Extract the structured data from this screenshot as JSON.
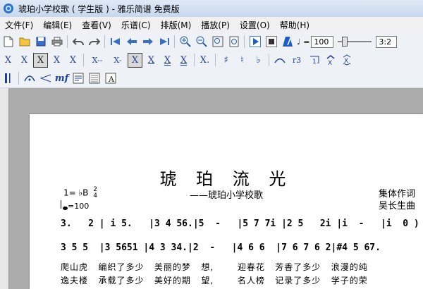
{
  "window": {
    "title": "琥珀小学校歌 ( 学生版 ) - 雅乐简谱 免费版"
  },
  "menu": [
    "文件(F)",
    "编辑(E)",
    "查看(V)",
    "乐谱(C)",
    "排版(M)",
    "播放(P)",
    "设置(O)",
    "帮助(H)"
  ],
  "toolbar1": {
    "speed_value": "100",
    "ratio_value": "3:2"
  },
  "toolbar2": {
    "buttons": [
      "X",
      "X",
      "X",
      "X",
      "X",
      "X--",
      "X-",
      "X",
      "X",
      "X",
      "X",
      "X.",
      "♯",
      "♮",
      "♭",
      "r3"
    ]
  },
  "toolbar3": {
    "dynamic_label": "mf"
  },
  "score": {
    "title": "琥 珀 流 光",
    "subtitle": "——琥珀小学校歌",
    "lyricist": "集体作词",
    "composer": "吴长生曲",
    "key": "1= ♭B",
    "time_top": "2",
    "time_bottom": "4",
    "tempo": "=100",
    "melody": "3.   2 | i 5.   |3 4 56.|5  -   |5 7 7i |2 5   2i |i  -   |i  0 )",
    "accompaniment": "3 5 5  |3 5651 |4 3 34.|2  -   |4 6 6  |7 6 7 6 2|#4 5 67.",
    "lyrics1": "爬山虎   编织了多少   美丽的梦   想,       迎春花   芳香了多少   浪漫的纯",
    "lyrics2": "逸夫楼   承载了多少   美好的期   望,       名人榜   记录了多少   学子的荣"
  }
}
